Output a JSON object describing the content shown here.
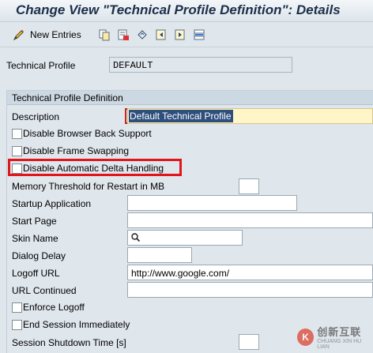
{
  "window": {
    "title": "Change View \"Technical Profile Definition\": Details"
  },
  "toolbar": {
    "new_entries_label": "New Entries",
    "icons": [
      "edit-pencil-icon",
      "copy-icon",
      "delete-icon",
      "undo-icon",
      "previous-entry-icon",
      "next-entry-icon",
      "select-block-icon"
    ]
  },
  "header": {
    "technical_profile_label": "Technical Profile",
    "technical_profile_value": "DEFAULT"
  },
  "group": {
    "title": "Technical Profile Definition",
    "description_label": "Description",
    "description_value": "Default Technical Profile",
    "disable_browser_back_label": "Disable Browser Back Support",
    "disable_frame_swapping_label": "Disable Frame Swapping",
    "disable_auto_delta_label": "Disable Automatic Delta Handling",
    "memory_threshold_label": "Memory Threshold for Restart in MB",
    "memory_threshold_value": "",
    "startup_application_label": "Startup Application",
    "startup_application_value": "",
    "start_page_label": "Start Page",
    "start_page_value": "",
    "skin_name_label": "Skin Name",
    "skin_name_value": "",
    "dialog_delay_label": "Dialog Delay",
    "dialog_delay_value": "",
    "logoff_url_label": "Logoff URL",
    "logoff_url_value": "http://www.google.com/",
    "url_continued_label": "URL Continued",
    "url_continued_value": "",
    "enforce_logoff_label": "Enforce Logoff",
    "end_session_label": "End Session Immediately",
    "session_shutdown_label": "Session Shutdown Time [s]",
    "session_shutdown_value": ""
  },
  "watermark": {
    "logo_glyph": "K",
    "text_cn": "创新互联",
    "text_en": "CHUANG XIN HU LIAN"
  },
  "colors": {
    "highlight_border": "#e0161b",
    "selection_bg": "#2e4e7d",
    "focus_field_bg": "#fff5c9"
  }
}
